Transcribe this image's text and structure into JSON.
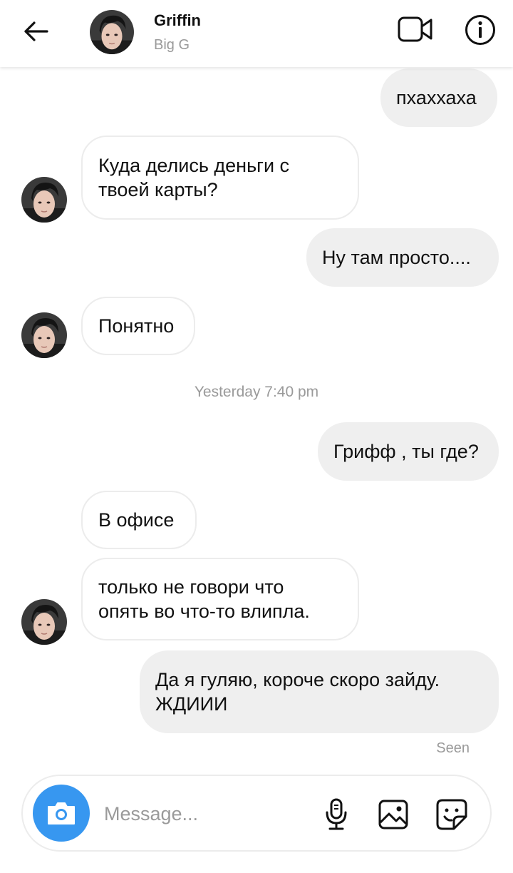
{
  "header": {
    "name": "Griffin",
    "subtitle": "Big G",
    "back_icon": "arrow-left-icon",
    "video_icon": "video-camera-icon",
    "info_icon": "info-icon"
  },
  "messages": [
    {
      "side": "out",
      "text": "пхаххаха"
    },
    {
      "side": "in",
      "lines": [
        "Куда делись деньги с",
        "твоей карты?"
      ]
    },
    {
      "side": "out",
      "text": "Ну там просто...."
    },
    {
      "side": "in",
      "text": "Понятно"
    },
    {
      "side": "out",
      "text": "Грифф , ты где?"
    },
    {
      "side": "in",
      "text": "В офисе"
    },
    {
      "side": "in",
      "lines": [
        "только не говори что",
        "опять во что-то влипла."
      ]
    },
    {
      "side": "out",
      "lines": [
        "Да я гуляю, короче скоро зайду.",
        "ЖДИИИ"
      ]
    }
  ],
  "timestamp": "Yesterday 7:40 pm",
  "seen_label": "Seen",
  "composer": {
    "placeholder": "Message...",
    "camera_icon": "camera-icon",
    "mic_icon": "microphone-icon",
    "gallery_icon": "image-icon",
    "sticker_icon": "sticker-icon"
  },
  "colors": {
    "accent": "#3797f0",
    "outgoing_bubble": "#efefef",
    "muted_text": "#9a9a9a"
  }
}
